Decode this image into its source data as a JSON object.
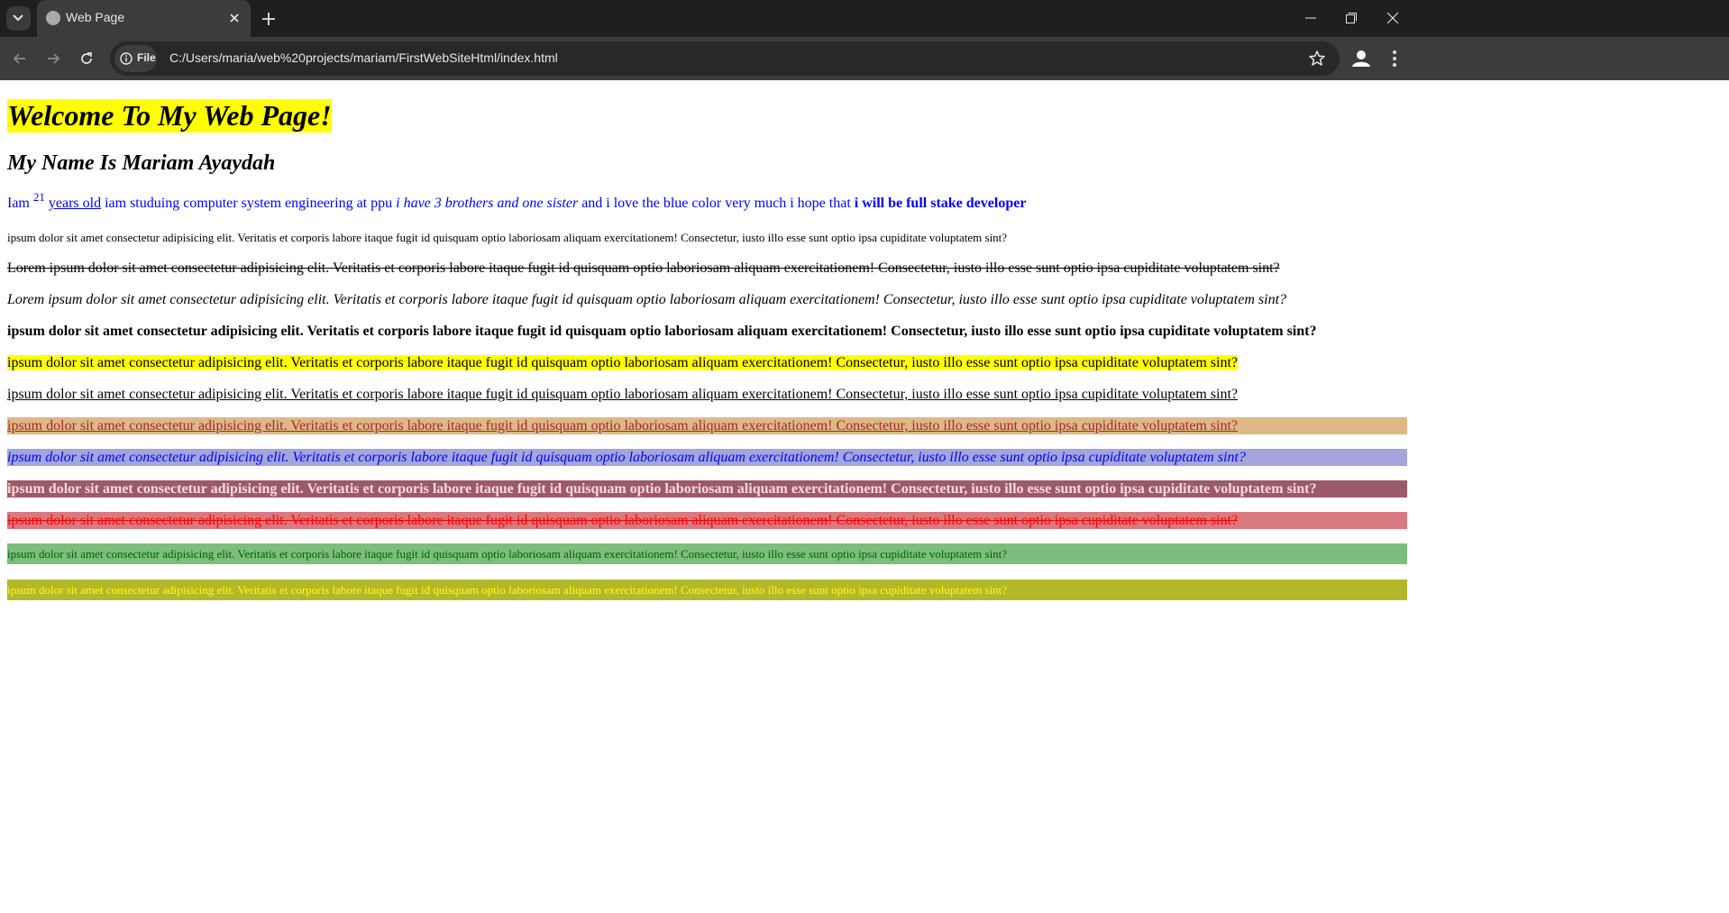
{
  "browser": {
    "tab_title": "Web Page",
    "site_chip_label": "File",
    "url": "C:/Users/maria/web%20projects/mariam/FirstWebSiteHtml/index.html"
  },
  "page": {
    "heading": "Welcome To My Web Page!",
    "subheading": "My Name Is Mariam Ayaydah",
    "intro": {
      "part1": "Iam ",
      "age": "21",
      "years_old": "years old",
      "part2": " iam studuing computer system engineering at ppu ",
      "italic": "i have 3 brothers and one sister",
      "part3": " and i love the blue color very much i hope that ",
      "bold": "i will be full stake developer"
    },
    "para_small": "ipsum dolor sit amet consectetur adipisicing elit. Veritatis et corporis labore itaque fugit id quisquam optio laboriosam aliquam exercitationem! Consectetur, iusto illo esse sunt optio ipsa cupiditate voluptatem sint?",
    "para_strike": "Lorem ipsum dolor sit amet consectetur adipisicing elit. Veritatis et corporis labore itaque fugit id quisquam optio laboriosam aliquam exercitationem! Consectetur, iusto illo esse sunt optio ipsa cupiditate voluptatem sint?",
    "para_italic": "Lorem ipsum dolor sit amet consectetur adipisicing elit. Veritatis et corporis labore itaque fugit id quisquam optio laboriosam aliquam exercitationem! Consectetur, iusto illo esse sunt optio ipsa cupiditate voluptatem sint?",
    "para_bold": "ipsum dolor sit amet consectetur adipisicing elit. Veritatis et corporis labore itaque fugit id quisquam optio laboriosam aliquam exercitationem! Consectetur, iusto illo esse sunt optio ipsa cupiditate voluptatem sint?",
    "para_yellow": "ipsum dolor sit amet consectetur adipisicing elit. Veritatis et corporis labore itaque fugit id quisquam optio laboriosam aliquam exercitationem! Consectetur, iusto illo esse sunt optio ipsa cupiditate voluptatem sint?",
    "para_underline": "ipsum dolor sit amet consectetur adipisicing elit. Veritatis et corporis labore itaque fugit id quisquam optio laboriosam aliquam exercitationem! Consectetur, iusto illo esse sunt optio ipsa cupiditate voluptatem sint?",
    "para_tan": "ipsum dolor sit amet consectetur adipisicing elit. Veritatis et corporis labore itaque fugit id quisquam optio laboriosam aliquam exercitationem! Consectetur, iusto illo esse sunt optio ipsa cupiditate voluptatem sint?",
    "para_lavender": "ipsum dolor sit amet consectetur adipisicing elit. Veritatis et corporis labore itaque fugit id quisquam optio laboriosam aliquam exercitationem! Consectetur, iusto illo esse sunt optio ipsa cupiditate voluptatem sint?",
    "para_mauve": "ipsum dolor sit amet consectetur adipisicing elit. Veritatis et corporis labore itaque fugit id quisquam optio laboriosam aliquam exercitationem! Consectetur, iusto illo esse sunt optio ipsa cupiditate voluptatem sint?",
    "para_rose": "ipsum dolor sit amet consectetur adipisicing elit. Veritatis et corporis labore itaque fugit id quisquam optio laboriosam aliquam exercitationem! Consectetur, iusto illo esse sunt optio ipsa cupiditate voluptatem sint?",
    "para_green": "ipsum dolor sit amet consectetur adipisicing elit. Veritatis et corporis labore itaque fugit id quisquam optio laboriosam aliquam exercitationem! Consectetur, iusto illo esse sunt optio ipsa cupiditate voluptatem sint?",
    "para_olive": "ipsum dolor sit amet consectetur adipisicing elit. Veritatis et corporis labore itaque fugit id quisquam optio laboriosam aliquam exercitationem! Consectetur, iusto illo esse sunt optio ipsa cupiditate voluptatem sint?"
  },
  "colors": {
    "tabbar_bg": "#1f1f1f",
    "toolbar_bg": "#3c3c3c",
    "highlight_yellow": "#ffff00",
    "text_blue": "#0000ff"
  },
  "icons": [
    "chevron-down-icon",
    "globe-icon",
    "close-icon",
    "plus-icon",
    "minimize-icon",
    "restore-icon",
    "back-icon",
    "forward-icon",
    "reload-icon",
    "info-icon",
    "star-icon",
    "profile-icon",
    "kebab-menu-icon"
  ]
}
